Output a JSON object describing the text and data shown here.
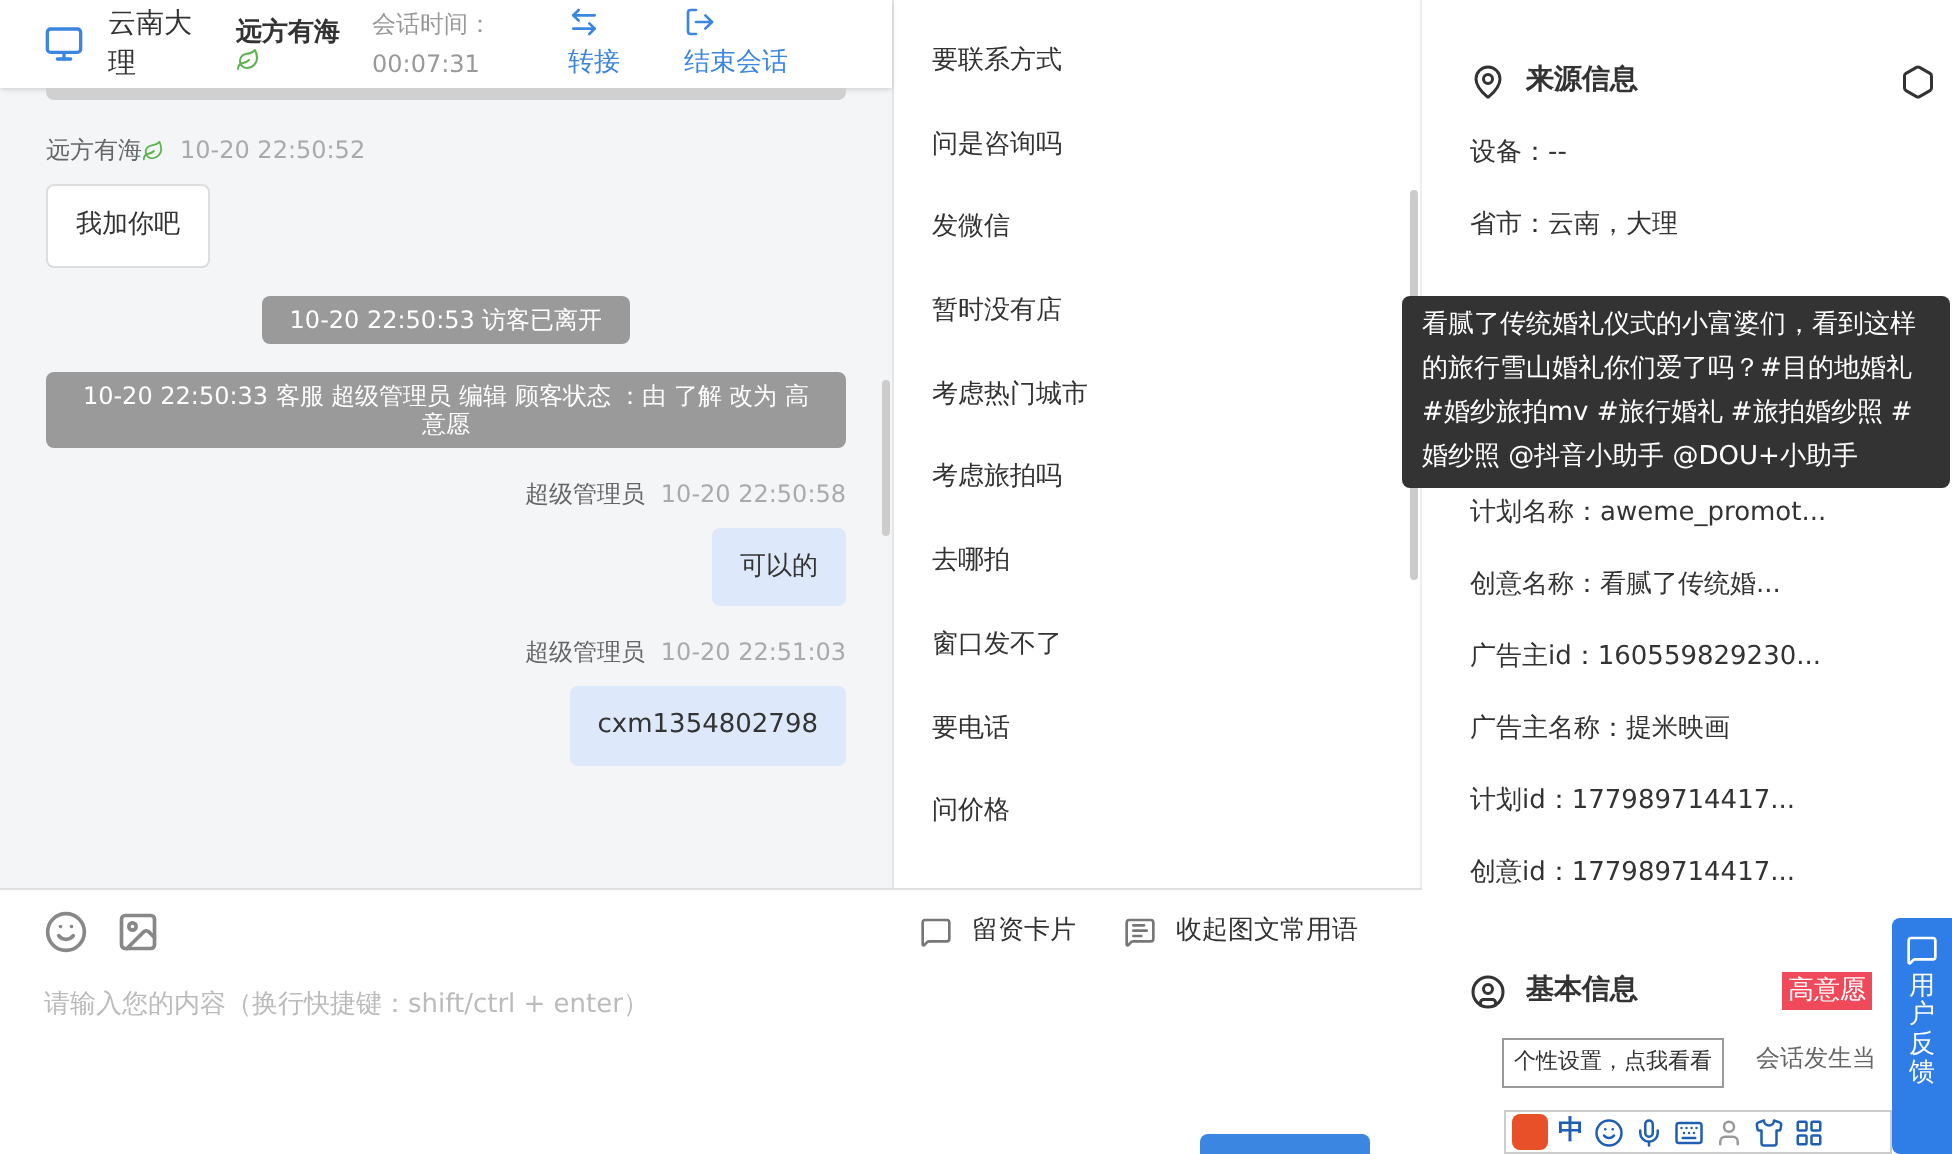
{
  "header": {
    "location": "云南大理",
    "visitor": "远方有海",
    "timer_label": "会话时间：",
    "timer": "00:07:31",
    "actions": [
      {
        "kind": "transfer",
        "label": "转接"
      },
      {
        "kind": "end",
        "label": "结束会话"
      }
    ]
  },
  "messages": [
    {
      "kind": "visitor",
      "name": "远方有海",
      "time": "10-20 22:50:52",
      "text": "我加你吧"
    },
    {
      "kind": "system",
      "text": "10-20 22:50:53 访客已离开"
    },
    {
      "kind": "system",
      "text": "10-20 22:50:33 客服 超级管理员 编辑 顾客状态 ：由 了解 改为 高意愿"
    },
    {
      "kind": "agent",
      "name": "超级管理员",
      "time": "10-20 22:50:58",
      "text": "可以的"
    },
    {
      "kind": "agent",
      "name": "超级管理员",
      "time": "10-20 22:51:03",
      "text": "cxm1354802798"
    }
  ],
  "quick_phrases": [
    "要联系方式",
    "问是咨询吗",
    "发微信",
    "暂时没有店",
    "考虑热门城市",
    "考虑旅拍吗",
    "去哪拍",
    "窗口发不了",
    "要电话",
    "问价格"
  ],
  "composer": {
    "tools": [
      {
        "kind": "card",
        "label": "留资卡片"
      },
      {
        "kind": "phrases",
        "label": "收起图文常用语"
      }
    ],
    "placeholder": "请输入您的内容（换行快捷键：shift/ctrl + enter）"
  },
  "source_info": {
    "title": "来源信息",
    "rows_top": [
      "设备：--",
      "省市：云南，大理"
    ],
    "rows_bottom": [
      "计划名称：aweme_promot...",
      "创意名称：看腻了传统婚...",
      "广告主id：160559829230...",
      "广告主名称：提米映画",
      "计划id：177989714417...",
      "创意id：177989714417..."
    ]
  },
  "tooltip": "看腻了传统婚礼仪式的小富婆们，看到这样的旅行雪山婚礼你们爱了吗？#目的地婚礼 #婚纱旅拍mv #旅行婚礼 #旅拍婚纱照 #婚纱照 @抖音小助手 @DOU+小助手",
  "basic_info": {
    "title": "基本信息",
    "tag": "高意愿",
    "text": "会话发生当"
  },
  "feedback": "用户反馈",
  "ime": {
    "tooltip": "个性设置，点我看看",
    "mode": "中"
  }
}
